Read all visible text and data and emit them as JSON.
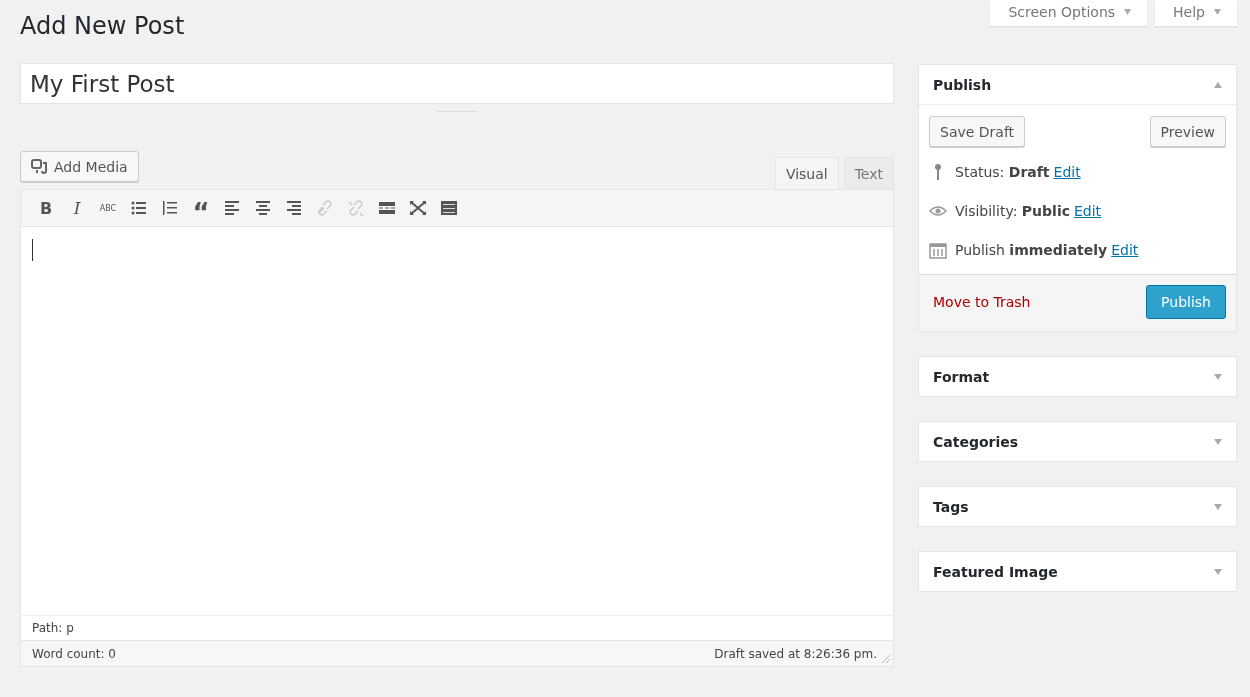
{
  "header_tabs": [
    {
      "label": "Screen Options",
      "expanded": false
    },
    {
      "label": "Help",
      "expanded": false
    }
  ],
  "page_title": "Add New Post",
  "post_title": {
    "value": "My First Post"
  },
  "add_media": {
    "label": "Add Media"
  },
  "editor_tabs": [
    {
      "label": "Visual",
      "selected": true
    },
    {
      "label": "Text",
      "selected": false
    }
  ],
  "toolbar": [
    {
      "kind": "bold",
      "label": "B",
      "disabled": false
    },
    {
      "kind": "italic",
      "label": "I",
      "disabled": false
    },
    {
      "kind": "strike",
      "label": "ABC",
      "disabled": false
    },
    {
      "kind": "bullets",
      "disabled": false
    },
    {
      "kind": "numbers",
      "disabled": false
    },
    {
      "kind": "quote",
      "label": "“",
      "disabled": false
    },
    {
      "kind": "align-left",
      "disabled": false
    },
    {
      "kind": "align-center",
      "disabled": false
    },
    {
      "kind": "align-right",
      "disabled": false
    },
    {
      "kind": "link",
      "disabled": true
    },
    {
      "kind": "unlink",
      "disabled": true
    },
    {
      "kind": "more",
      "disabled": false
    },
    {
      "kind": "fullscreen",
      "disabled": false
    },
    {
      "kind": "kitchen-sink",
      "disabled": false
    }
  ],
  "editor": {
    "path": "Path: p",
    "word_count": "Word count: 0",
    "draft_saved": "Draft saved at 8:26:36 pm."
  },
  "publish_box": {
    "title": "Publish",
    "expanded": true,
    "save_draft": "Save Draft",
    "preview": "Preview",
    "rows": [
      {
        "kind": "pin",
        "text": "Status: **Draft**",
        "link": "Edit"
      },
      {
        "kind": "eye",
        "text": "Visibility: **Public**",
        "link": "Edit"
      },
      {
        "kind": "calendar",
        "text": "Publish **immediately**",
        "link": "Edit"
      }
    ],
    "trash": "Move to Trash",
    "publish": "Publish"
  },
  "meta_boxes": [
    {
      "title": "Format",
      "expanded": false
    },
    {
      "title": "Categories",
      "expanded": false
    },
    {
      "title": "Tags",
      "expanded": false
    },
    {
      "title": "Featured Image",
      "expanded": false
    }
  ]
}
